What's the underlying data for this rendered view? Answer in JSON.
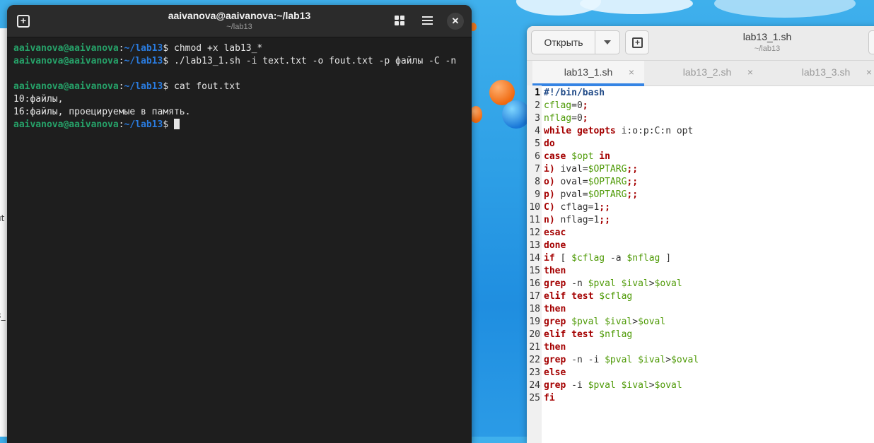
{
  "terminal": {
    "title": "aaivanova@aaivanova:~/lab13",
    "subtitle": "~/lab13",
    "lines": [
      {
        "user": "aaivanova@aaivanova",
        "colon": ":",
        "dir": "~/lab13",
        "sign": "$ ",
        "cmd": "chmod +x lab13_*"
      },
      {
        "user": "aaivanova@aaivanova",
        "colon": ":",
        "dir": "~/lab13",
        "sign": "$ ",
        "cmd": "./lab13_1.sh -i text.txt -o fout.txt -p файлы -C -n"
      },
      {
        "text": ""
      },
      {
        "user": "aaivanova@aaivanova",
        "colon": ":",
        "dir": "~/lab13",
        "sign": "$ ",
        "cmd": "cat fout.txt"
      },
      {
        "text": "10:файлы,"
      },
      {
        "text": "16:файлы, проецируемые в память."
      },
      {
        "user": "aaivanova@aaivanova",
        "colon": ":",
        "dir": "~/lab13",
        "sign": "$ ",
        "cmd": ""
      }
    ]
  },
  "editor": {
    "open_label": "Открыть",
    "title": "lab13_1.sh",
    "subtitle": "~/lab13",
    "tabs": [
      {
        "label": "lab13_1.sh",
        "close": "×"
      },
      {
        "label": "lab13_2.sh",
        "close": "×"
      },
      {
        "label": "lab13_3.sh",
        "close": "×"
      }
    ],
    "code": [
      {
        "n": "1",
        "s": [
          [
            "sb",
            "#!/bin/bash"
          ]
        ]
      },
      {
        "n": "2",
        "s": [
          [
            "vr",
            "cflag"
          ],
          [
            "",
            "=0"
          ],
          [
            "op",
            ";"
          ]
        ]
      },
      {
        "n": "3",
        "s": [
          [
            "vr",
            "nflag"
          ],
          [
            "",
            "=0"
          ],
          [
            "op",
            ";"
          ]
        ]
      },
      {
        "n": "4",
        "s": [
          [
            "kw",
            "while"
          ],
          [
            "",
            " "
          ],
          [
            "kw",
            "getopts"
          ],
          [
            "",
            " i:o:p:C:n opt"
          ]
        ]
      },
      {
        "n": "5",
        "s": [
          [
            "kw",
            "do"
          ]
        ]
      },
      {
        "n": "6",
        "s": [
          [
            "kw",
            "case"
          ],
          [
            "",
            " "
          ],
          [
            "vr",
            "$opt"
          ],
          [
            "",
            " "
          ],
          [
            "kw",
            "in"
          ]
        ]
      },
      {
        "n": "7",
        "s": [
          [
            "kw",
            "i)"
          ],
          [
            "",
            " ival="
          ],
          [
            "vr",
            "$OPTARG"
          ],
          [
            "op",
            ";;"
          ]
        ]
      },
      {
        "n": "8",
        "s": [
          [
            "kw",
            "o)"
          ],
          [
            "",
            " oval="
          ],
          [
            "vr",
            "$OPTARG"
          ],
          [
            "op",
            ";;"
          ]
        ]
      },
      {
        "n": "9",
        "s": [
          [
            "kw",
            "p)"
          ],
          [
            "",
            " pval="
          ],
          [
            "vr",
            "$OPTARG"
          ],
          [
            "op",
            ";;"
          ]
        ]
      },
      {
        "n": "10",
        "s": [
          [
            "kw",
            "C)"
          ],
          [
            "",
            " cflag=1"
          ],
          [
            "op",
            ";;"
          ]
        ]
      },
      {
        "n": "11",
        "s": [
          [
            "kw",
            "n)"
          ],
          [
            "",
            " nflag=1"
          ],
          [
            "op",
            ";;"
          ]
        ]
      },
      {
        "n": "12",
        "s": [
          [
            "kw",
            "esac"
          ]
        ]
      },
      {
        "n": "13",
        "s": [
          [
            "kw",
            "done"
          ]
        ]
      },
      {
        "n": "14",
        "s": [
          [
            "kw",
            "if"
          ],
          [
            "",
            " [ "
          ],
          [
            "vr",
            "$cflag"
          ],
          [
            "",
            " -a "
          ],
          [
            "vr",
            "$nflag"
          ],
          [
            "",
            " ]"
          ]
        ]
      },
      {
        "n": "15",
        "s": [
          [
            "kw",
            "then"
          ]
        ]
      },
      {
        "n": "16",
        "s": [
          [
            "kw",
            "grep"
          ],
          [
            "",
            " -n "
          ],
          [
            "vr",
            "$pval"
          ],
          [
            "",
            " "
          ],
          [
            "vr",
            "$ival"
          ],
          [
            "",
            ">"
          ],
          [
            "vr",
            "$oval"
          ]
        ]
      },
      {
        "n": "17",
        "s": [
          [
            "kw",
            "elif"
          ],
          [
            "",
            " "
          ],
          [
            "kw",
            "test"
          ],
          [
            "",
            " "
          ],
          [
            "vr",
            "$cflag"
          ]
        ]
      },
      {
        "n": "18",
        "s": [
          [
            "kw",
            "then"
          ]
        ]
      },
      {
        "n": "19",
        "s": [
          [
            "kw",
            "grep"
          ],
          [
            "",
            " "
          ],
          [
            "vr",
            "$pval"
          ],
          [
            "",
            " "
          ],
          [
            "vr",
            "$ival"
          ],
          [
            "",
            ">"
          ],
          [
            "vr",
            "$oval"
          ]
        ]
      },
      {
        "n": "20",
        "s": [
          [
            "kw",
            "elif"
          ],
          [
            "",
            " "
          ],
          [
            "kw",
            "test"
          ],
          [
            "",
            " "
          ],
          [
            "vr",
            "$nflag"
          ]
        ]
      },
      {
        "n": "21",
        "s": [
          [
            "kw",
            "then"
          ]
        ]
      },
      {
        "n": "22",
        "s": [
          [
            "kw",
            "grep"
          ],
          [
            "",
            " -n -i "
          ],
          [
            "vr",
            "$pval"
          ],
          [
            "",
            " "
          ],
          [
            "vr",
            "$ival"
          ],
          [
            "",
            ">"
          ],
          [
            "vr",
            "$oval"
          ]
        ]
      },
      {
        "n": "23",
        "s": [
          [
            "kw",
            "else"
          ]
        ]
      },
      {
        "n": "24",
        "s": [
          [
            "kw",
            "grep"
          ],
          [
            "",
            " -i "
          ],
          [
            "vr",
            "$pval"
          ],
          [
            "",
            " "
          ],
          [
            "vr",
            "$ival"
          ],
          [
            "",
            ">"
          ],
          [
            "vr",
            "$oval"
          ]
        ]
      },
      {
        "n": "25",
        "s": [
          [
            "kw",
            "fi"
          ]
        ]
      }
    ]
  },
  "background_window": {
    "fragments": [
      "ut",
      "3_"
    ]
  }
}
